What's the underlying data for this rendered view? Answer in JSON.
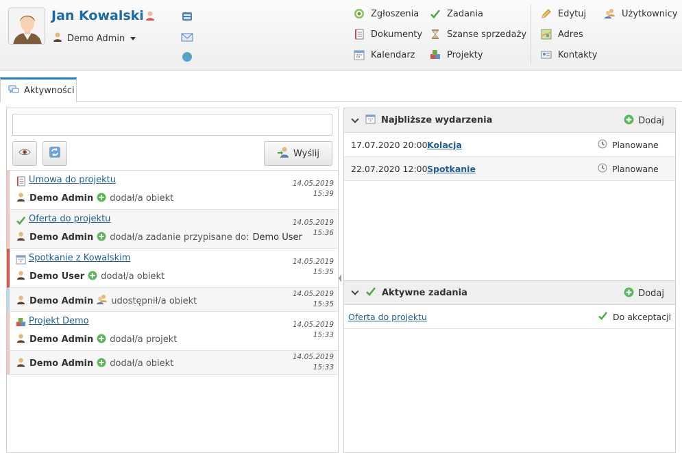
{
  "header": {
    "user_name": "Jan Kowalski",
    "role": "Demo Admin",
    "menu": [
      {
        "label": "Zgłoszenia",
        "icon": "target-icon"
      },
      {
        "label": "Dokumenty",
        "icon": "document-icon"
      },
      {
        "label": "Kalendarz",
        "icon": "calendar-icon"
      },
      {
        "label": "Zadania",
        "icon": "check-icon"
      },
      {
        "label": "Szanse sprzedaży",
        "icon": "hourglass-icon"
      },
      {
        "label": "Projekty",
        "icon": "cubes-icon"
      },
      {
        "label": "Edytuj",
        "icon": "pencil-icon"
      },
      {
        "label": "Adres",
        "icon": "map-icon"
      },
      {
        "label": "Kontakty",
        "icon": "contact-card-icon"
      },
      {
        "label": "Użytkownicy",
        "icon": "users-icon"
      }
    ]
  },
  "tabs": [
    {
      "label": "Aktywności"
    }
  ],
  "activity": {
    "input_value": "",
    "send_label": "Wyślij",
    "items": [
      {
        "title": "Umowa do projektu",
        "icon": "document-icon",
        "user": "Demo Admin",
        "action": "dodał/a obiekt",
        "target": "",
        "date": "14.05.2019",
        "time": "15:39"
      },
      {
        "title": "Oferta do projektu",
        "icon": "check-icon",
        "user": "Demo Admin",
        "action": "dodał/a zadanie przypisane do:",
        "target": "Demo User",
        "date": "14.05.2019",
        "time": "15:36"
      },
      {
        "title": "Spotkanie z Kowalskim",
        "icon": "calendar-icon",
        "user": "Demo User",
        "action": "dodał/a obiekt",
        "target": "",
        "date": "14.05.2019",
        "time": "15:35"
      },
      {
        "title": "",
        "icon": "",
        "user": "Demo Admin",
        "action": "udostępnił/a obiekt",
        "target": "",
        "date": "14.05.2019",
        "time": "15:35"
      },
      {
        "title": "Projekt Demo",
        "icon": "cubes-icon",
        "user": "Demo Admin",
        "action": "dodał/a projekt",
        "target": "",
        "date": "14.05.2019",
        "time": "15:33"
      },
      {
        "title": "",
        "icon": "",
        "user": "Demo Admin",
        "action": "dodał/a obiekt",
        "target": "",
        "date": "14.05.2019",
        "time": "15:33"
      }
    ]
  },
  "events": {
    "title": "Najbliższe wydarzenia",
    "add_label": "Dodaj",
    "rows": [
      {
        "date": "17.07.2020 20:00",
        "name": "Kolacja",
        "status": "Planowane"
      },
      {
        "date": "22.07.2020 12:00",
        "name": "Spotkanie",
        "status": "Planowane"
      }
    ]
  },
  "tasks": {
    "title": "Aktywne zadania",
    "add_label": "Dodaj",
    "rows": [
      {
        "name": "Oferta do projektu",
        "status": "Do akceptacji"
      }
    ]
  },
  "colors": {
    "accent": "#1b7ac9",
    "link": "#1d5f96",
    "name": "#1a6aa7"
  }
}
